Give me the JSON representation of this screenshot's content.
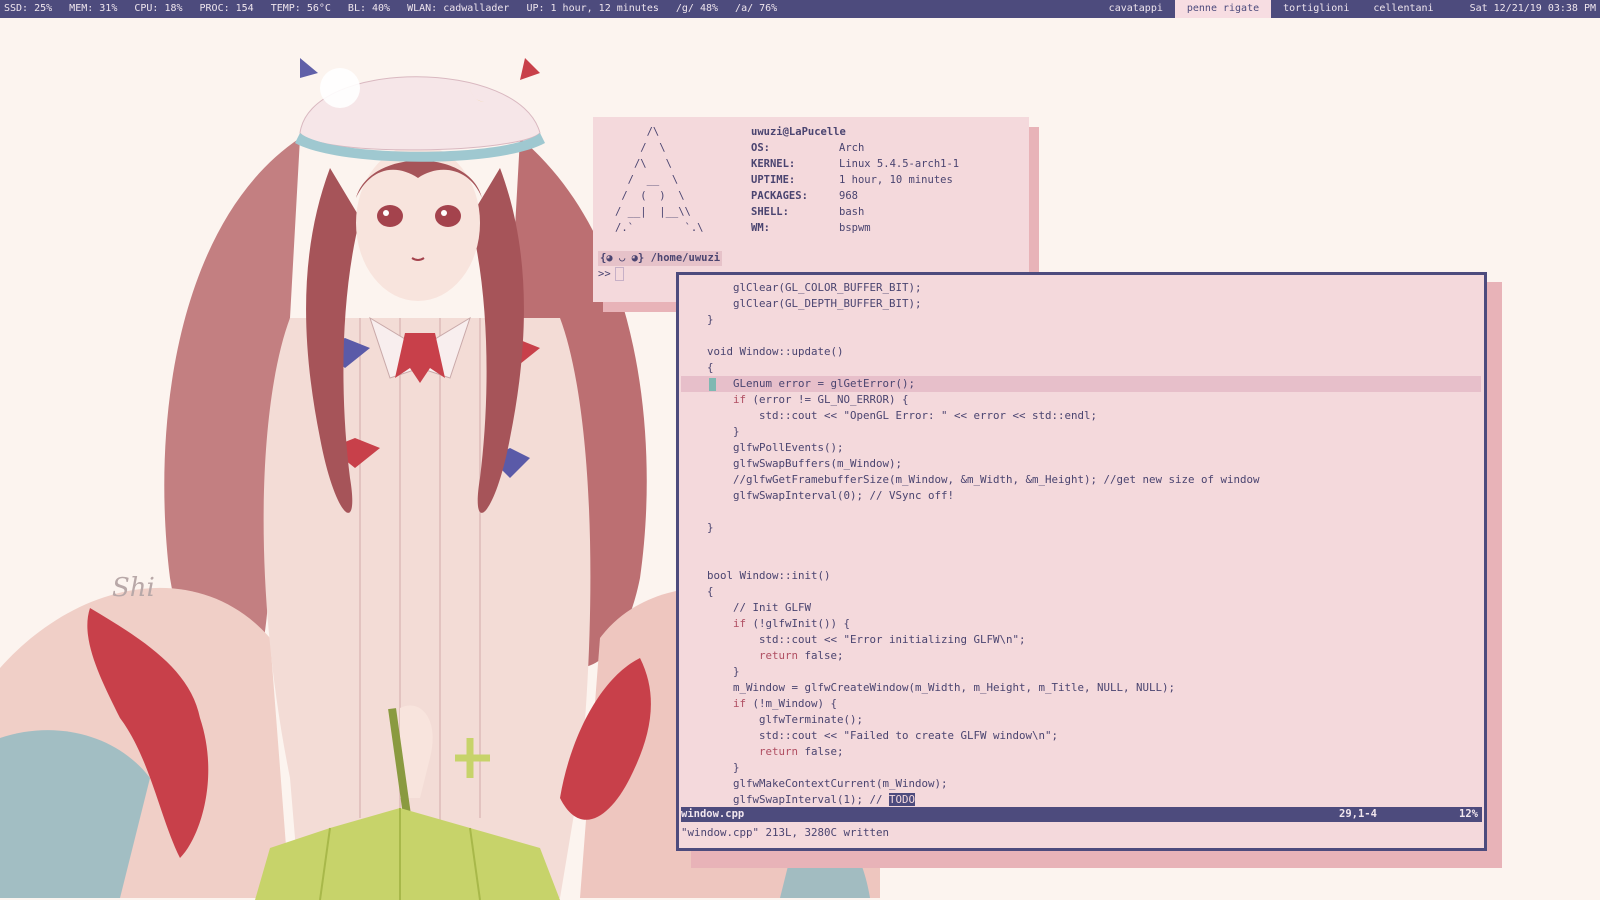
{
  "topbar": {
    "stats": [
      "SSD: 25%",
      "MEM: 31%",
      "CPU: 18%",
      "PROC: 154",
      "TEMP: 56°C",
      "BL: 40%",
      "WLAN: cadwallader",
      "UP: 1 hour, 12 minutes",
      "/g/ 48%",
      "/a/ 76%"
    ],
    "workspaces": [
      {
        "label": "cavatappi",
        "active": false
      },
      {
        "label": "penne rigate",
        "active": true
      },
      {
        "label": "tortiglioni",
        "active": false
      },
      {
        "label": "cellentani",
        "active": false
      }
    ],
    "clock": "Sat 12/21/19 03:38 PM"
  },
  "terminal": {
    "logo": "     /\\\n    /  \\\n   /\\   \\\n  /  __  \\\n /  (  )  \\\n/ __|  |__\\\\\n/.`        `.\\",
    "user_host": "uwuzi@LaPucelle",
    "info": [
      {
        "key": "OS:",
        "value": "Arch"
      },
      {
        "key": "KERNEL:",
        "value": "Linux 5.4.5-arch1-1"
      },
      {
        "key": "UPTIME:",
        "value": "1 hour, 10 minutes"
      },
      {
        "key": "PACKAGES:",
        "value": "968"
      },
      {
        "key": "SHELL:",
        "value": "bash"
      },
      {
        "key": "WM:",
        "value": "bspwm"
      }
    ],
    "prompt": "{◕ ◡ ◕} /home/uwuzi",
    "prompt_symbol": ">>"
  },
  "editor": {
    "lines": [
      {
        "text": "        glClear(GL_COLOR_BUFFER_BIT);"
      },
      {
        "text": "        glClear(GL_DEPTH_BUFFER_BIT);"
      },
      {
        "text": "    }"
      },
      {
        "text": ""
      },
      {
        "text": "    void Window::update()"
      },
      {
        "text": "    {"
      },
      {
        "text": "        GLenum error = glGetError();",
        "current": true
      },
      {
        "text": "        if (error != GL_NO_ERROR) {",
        "kw": "if"
      },
      {
        "text": "            std::cout << \"OpenGL Error: \" << error << std::endl;"
      },
      {
        "text": "        }"
      },
      {
        "text": "        glfwPollEvents();"
      },
      {
        "text": "        glfwSwapBuffers(m_Window);"
      },
      {
        "text": "        //glfwGetFramebufferSize(m_Window, &m_Width, &m_Height); //get new size of window"
      },
      {
        "text": "        glfwSwapInterval(0); // VSync off!"
      },
      {
        "text": ""
      },
      {
        "text": "    }"
      },
      {
        "text": ""
      },
      {
        "text": ""
      },
      {
        "text": "    bool Window::init()"
      },
      {
        "text": "    {"
      },
      {
        "text": "        // Init GLFW"
      },
      {
        "text": "        if (!glfwInit()) {",
        "kw": "if"
      },
      {
        "text": "            std::cout << \"Error initializing GLFW\\n\";"
      },
      {
        "text": "            return false;",
        "kw": "return"
      },
      {
        "text": "        }"
      },
      {
        "text": "        m_Window = glfwCreateWindow(m_Width, m_Height, m_Title, NULL, NULL);"
      },
      {
        "text": "        if (!m_Window) {",
        "kw": "if"
      },
      {
        "text": "            glfwTerminate();"
      },
      {
        "text": "            std::cout << \"Failed to create GLFW window\\n\";"
      },
      {
        "text": "            return false;",
        "kw": "return"
      },
      {
        "text": "        }"
      },
      {
        "text": "        glfwMakeContextCurrent(m_Window);"
      },
      {
        "text": "        glfwSwapInterval(1); // ",
        "todo": "TODO"
      }
    ],
    "status": {
      "filename": "window.cpp",
      "position": "29,1-4",
      "percent": "12%"
    },
    "message": "\"window.cpp\" 213L, 3280C written"
  },
  "art": {
    "signature": "Shi",
    "colors": {
      "hair": "#b0575c",
      "dress": "#f0cfc7",
      "ribbon": "#c8404a",
      "bow": "#5a5aa8",
      "umbrella": "#c7d36a",
      "hat": "#f6e6e8"
    }
  }
}
